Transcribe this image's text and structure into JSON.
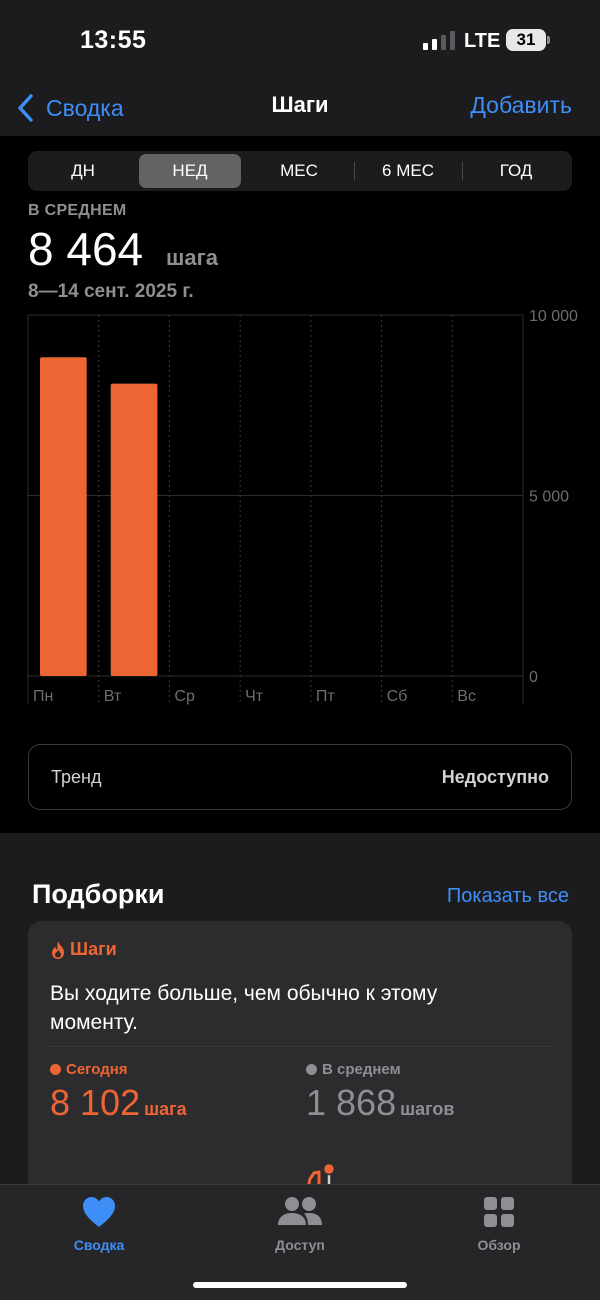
{
  "status_bar": {
    "time": "13:55",
    "network": "LTE",
    "battery": "31"
  },
  "nav": {
    "back_label": "Сводка",
    "title": "Шаги",
    "add_label": "Добавить"
  },
  "segments": [
    {
      "label": "ДН",
      "active": false
    },
    {
      "label": "НЕД",
      "active": true
    },
    {
      "label": "МЕС",
      "active": false
    },
    {
      "label": "6 МЕС",
      "active": false
    },
    {
      "label": "ГОД",
      "active": false
    }
  ],
  "summary": {
    "average_label": "В СРЕДНЕМ",
    "average_value": "8 464",
    "average_unit": "шага",
    "date_range": "8—14 сент. 2025 г."
  },
  "chart_data": {
    "type": "bar",
    "categories": [
      "Пн",
      "Вт",
      "Ср",
      "Чт",
      "Пт",
      "Сб",
      "Вс"
    ],
    "values": [
      8830,
      8100,
      null,
      null,
      null,
      null,
      null
    ],
    "ylim": [
      0,
      10000
    ],
    "y_ticks": [
      0,
      5000,
      10000
    ],
    "y_tick_labels": [
      "0",
      "5 000",
      "10 000"
    ],
    "bar_color": "#ee6534",
    "grid": true
  },
  "trend": {
    "label": "Тренд",
    "status": "Недоступно"
  },
  "highlights": {
    "title": "Подборки",
    "show_all_label": "Показать все",
    "card": {
      "tag": "Шаги",
      "tag_icon": "flame-icon",
      "text": "Вы ходите больше, чем обычно к этому моменту.",
      "today": {
        "label": "Сегодня",
        "value": "8 102",
        "unit": "шага",
        "color": "#ee6534"
      },
      "average": {
        "label": "В среднем",
        "value": "1 868",
        "unit": "шагов",
        "color": "#8e8e93"
      }
    }
  },
  "tabs": [
    {
      "label": "Сводка",
      "icon": "heart-icon",
      "active": true
    },
    {
      "label": "Доступ",
      "icon": "people-icon",
      "active": false
    },
    {
      "label": "Обзор",
      "icon": "grid-icon",
      "active": false
    }
  ],
  "colors": {
    "accent": "#3d8ef7",
    "steps": "#ee6534",
    "background": "#000000"
  }
}
